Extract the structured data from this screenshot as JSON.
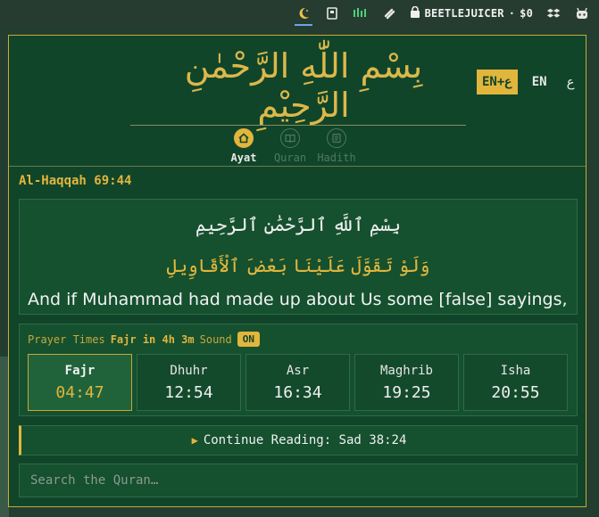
{
  "menubar": {
    "icons": [
      "crescent-icon",
      "book-icon",
      "chart-icon",
      "link-icon",
      "lock-icon",
      "dropbox-icon",
      "robot-icon"
    ],
    "account_name": "BEETLEJUICER",
    "separator": "·",
    "balance": "$0"
  },
  "header": {
    "bismillah": "بِسْمِ اللّٰهِ الرَّحْمٰنِ الرَّحِيْمِ",
    "lang_buttons": [
      {
        "label": "EN+ع",
        "active": true
      },
      {
        "label": "EN",
        "active": false
      },
      {
        "label": "ع",
        "active": false
      }
    ],
    "tabs": [
      {
        "label": "Ayat",
        "icon": "home-icon",
        "active": true
      },
      {
        "label": "Quran",
        "icon": "open-book-icon",
        "active": false
      },
      {
        "label": "Hadith",
        "icon": "scroll-icon",
        "active": false
      }
    ]
  },
  "ayah": {
    "reference": "Al-Haqqah 69:44",
    "bismillah": "بِسْمِ ٱللَّهِ ٱلرَّحْمَٰنِ ٱلرَّحِيمِ",
    "arabic": "وَلَوْ تَقَوَّلَ عَلَيْنَا بَعْضَ ٱلْأَقَاوِيلِ",
    "translation": "And if Muhammad had made up about Us some [false] sayings,"
  },
  "prayer": {
    "title": "Prayer Times",
    "next": "Fajr in 4h 3m",
    "sound_label": "Sound",
    "sound_state": "ON",
    "times": [
      {
        "name": "Fajr",
        "time": "04:47",
        "active": true
      },
      {
        "name": "Dhuhr",
        "time": "12:54",
        "active": false
      },
      {
        "name": "Asr",
        "time": "16:34",
        "active": false
      },
      {
        "name": "Maghrib",
        "time": "19:25",
        "active": false
      },
      {
        "name": "Isha",
        "time": "20:55",
        "active": false
      }
    ]
  },
  "continue_reading": {
    "icon": "play-icon",
    "label": "Continue Reading: Sad 38:24"
  },
  "search": {
    "placeholder": "Search the Quran…"
  },
  "colors": {
    "panel_bg": "#10452a",
    "accent_gold": "#e2b53c",
    "border_gold": "#c9a83a"
  }
}
